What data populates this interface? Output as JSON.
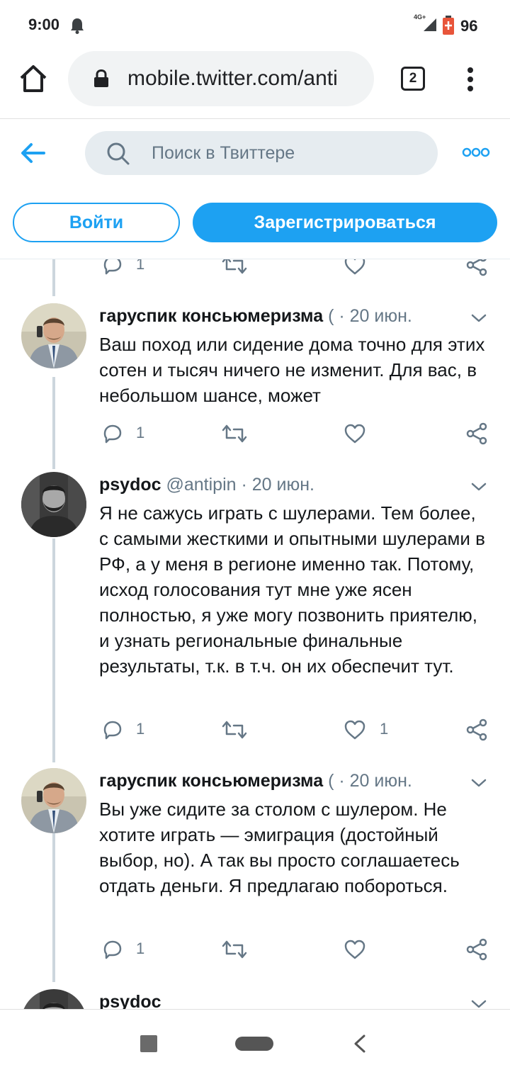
{
  "status_bar": {
    "time": "9:00",
    "network": "4G+",
    "battery": "96"
  },
  "browser": {
    "url": "mobile.twitter.com/anti",
    "tab_count": "2"
  },
  "twitter_header": {
    "search_placeholder": "Поиск в Твиттере",
    "login_label": "Войти",
    "signup_label": "Зарегистрироваться"
  },
  "partial_top_actions": {
    "reply_count": "1"
  },
  "tweets": [
    {
      "name": "гаруспик консьюмеризма",
      "handle": "(",
      "sep": "·",
      "date": "20 июн.",
      "text": "Ваш поход или сидение дома точно для этих сотен и тысяч ничего не изменит. Для вас, в небольшом шансе, может",
      "reply_count": "1",
      "like_count": ""
    },
    {
      "name": "psydoc",
      "handle": "@antipin",
      "sep": "·",
      "date": "20 июн.",
      "text": "Я не сажусь играть с шулерами. Тем более, с самыми жесткими и опытными шулерами в РФ, а у меня в регионе именно так. Потому, исход голосования тут мне уже ясен полностью, я уже могу позвонить приятелю, и узнать региональные финальные результаты, т.к. в т.ч. он их обеспечит тут.",
      "reply_count": "1",
      "like_count": "1"
    },
    {
      "name": "гаруспик консьюмеризма",
      "handle": "(",
      "sep": "·",
      "date": "20 июн.",
      "text": "Вы уже сидите за столом с шулером. Не хотите играть — эмиграция (достойный выбор, но). А так вы просто соглашаетесь отдать деньги. Я предлагаю побороться.",
      "reply_count": "1",
      "like_count": ""
    },
    {
      "name": "psydoc",
      "handle": "",
      "sep": "",
      "date": "",
      "text": "",
      "reply_count": "",
      "like_count": ""
    }
  ]
}
